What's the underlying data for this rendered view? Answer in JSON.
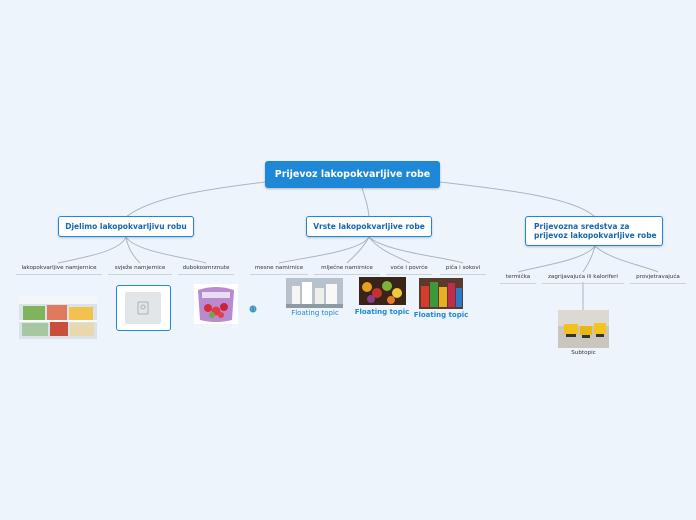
{
  "root": {
    "label": "Prijevoz lakopokvarljive robe"
  },
  "branches": [
    {
      "label": "Djelimo lakopokvarljivu robu",
      "children": [
        "lakopokvarljive namjernice",
        "svježe namjernice",
        "dubokosmrznute"
      ]
    },
    {
      "label": "Vrste lakopokvarljive robe",
      "children": [
        "mesne namirnice",
        "mlječne namirnice",
        "voće i povrće",
        "piča i sokovi"
      ]
    },
    {
      "label": "Prijevozna sredstva za prijevoz lakopokvarljive robe",
      "children": [
        "termička",
        "zagrijavajuća ili kaloriferi",
        "provjetravajuća"
      ]
    }
  ],
  "floating_topics": [
    "Floating topic",
    "Floating topic",
    "Floating topic"
  ],
  "subtopic": "Subtopic",
  "icons": [
    "image-placeholder-icon",
    "globe-icon"
  ],
  "colors": {
    "accent": "#1e88d6",
    "background": "#eef4fb"
  }
}
